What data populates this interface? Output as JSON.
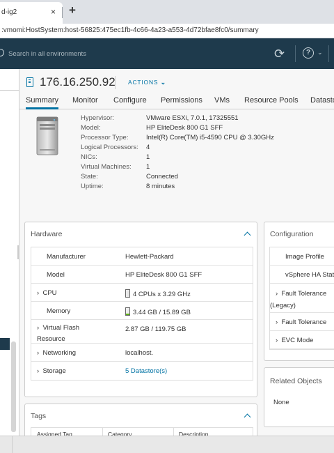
{
  "browser": {
    "tab_title": "d-ig2",
    "close_glyph": "×",
    "new_tab_glyph": "+",
    "url": ":vmomi:HostSystem:host-56825:475ec1fb-4c66-4a23-a553-4d72bfae8fc0/summary"
  },
  "header": {
    "search_placeholder": "Search in all environments",
    "refresh_glyph": "⟳",
    "help_glyph": "?",
    "chevron_glyph": "⌄"
  },
  "object": {
    "title": "176.16.250.92",
    "actions_label": "ACTIONS",
    "actions_chevron": "⌄"
  },
  "tabs": [
    {
      "label": "Summary",
      "active": true
    },
    {
      "label": "Monitor"
    },
    {
      "label": "Configure"
    },
    {
      "label": "Permissions"
    },
    {
      "label": "VMs"
    },
    {
      "label": "Resource Pools"
    },
    {
      "label": "Datasto"
    }
  ],
  "summary": {
    "rows": [
      {
        "key": "Hypervisor:",
        "value": "VMware ESXi, 7.0.1, 17325551"
      },
      {
        "key": "Model:",
        "value": "HP EliteDesk 800 G1 SFF"
      },
      {
        "key": "Processor Type:",
        "value": "Intel(R) Core(TM) i5-4590 CPU @ 3.30GHz"
      },
      {
        "key": "Logical Processors:",
        "value": "4"
      },
      {
        "key": "NICs:",
        "value": "1"
      },
      {
        "key": "Virtual Machines:",
        "value": "1"
      },
      {
        "key": "State:",
        "value": "Connected"
      },
      {
        "key": "Uptime:",
        "value": "8 minutes"
      }
    ]
  },
  "hardware": {
    "title": "Hardware",
    "rows": [
      {
        "key": "Manufacturer",
        "value": "Hewlett-Packard"
      },
      {
        "key": "Model",
        "value": "HP EliteDesk 800 G1 SFF"
      },
      {
        "key": "CPU",
        "value": "4 CPUs x 3.29 GHz",
        "expand": "›",
        "gauge_fill": 0.0,
        "gauge_color": "#e8e8e8"
      },
      {
        "key": "Memory",
        "value": "3.44 GB / 15.89 GB",
        "gauge_fill": 0.22,
        "gauge_color": "#60b515"
      },
      {
        "key_line1": "Virtual Flash",
        "key_line2": "Resource",
        "value": "2.87 GB / 119.75 GB",
        "expand": "›"
      },
      {
        "key": "Networking",
        "value": "localhost.",
        "expand": "›"
      },
      {
        "key": "Storage",
        "value": "5 Datastore(s)",
        "expand": "›"
      }
    ]
  },
  "configuration": {
    "title": "Configuration",
    "rows": [
      {
        "key": "Image Profile"
      },
      {
        "key": "vSphere HA Stat"
      },
      {
        "key_line1": "Fault Tolerance",
        "key_line2": "(Legacy)",
        "expand": "›"
      },
      {
        "key": "Fault Tolerance",
        "expand": "›"
      },
      {
        "key": "EVC Mode",
        "expand": "›"
      }
    ]
  },
  "related": {
    "title": "Related Objects",
    "value": "None"
  },
  "tags": {
    "title": "Tags",
    "columns": [
      "Assigned Tag",
      "Category",
      "Description"
    ]
  },
  "colors": {
    "header_bg": "#1e3a4c",
    "link": "#0072a3"
  }
}
